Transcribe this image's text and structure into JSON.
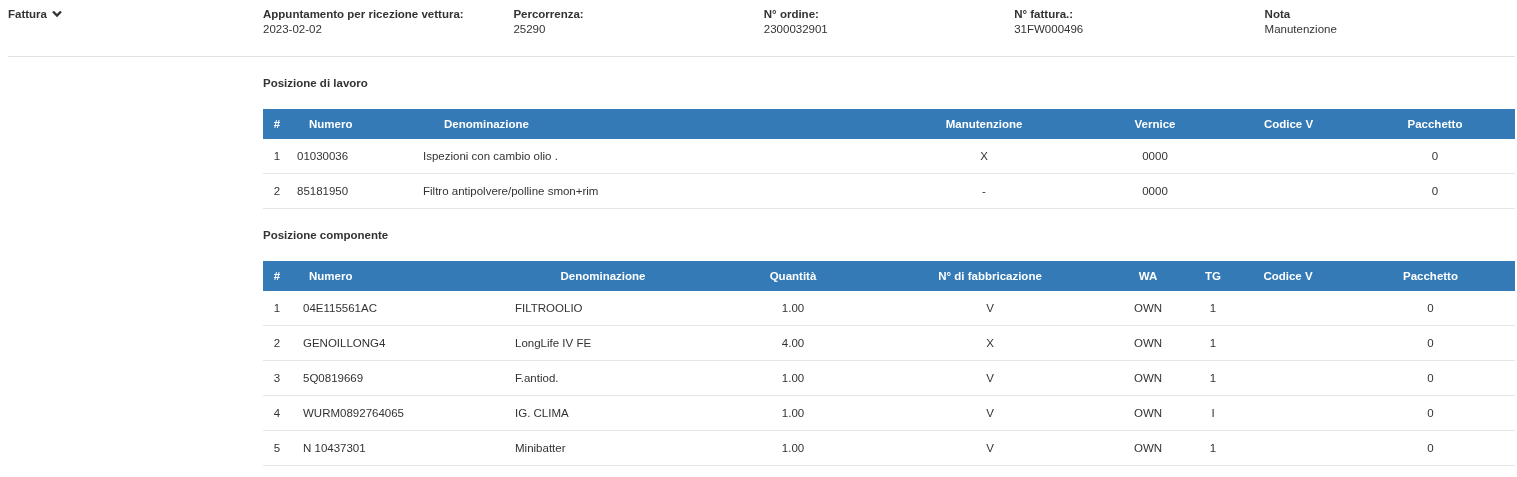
{
  "section": {
    "title": "Fattura",
    "expanded": true
  },
  "fields": [
    {
      "label": "Appuntamento per ricezione vettura:",
      "value": "2023-02-02"
    },
    {
      "label": "Percorrenza:",
      "value": "25290"
    },
    {
      "label": "N° ordine:",
      "value": "2300032901"
    },
    {
      "label": "N° fattura.:",
      "value": "31FW000496"
    },
    {
      "label": "Nota",
      "value": "Manutenzione"
    }
  ],
  "tables": [
    {
      "title": "Posizione di lavoro",
      "columns": [
        "#",
        "Numero",
        "Denominazione",
        "Manutenzione",
        "Vernice",
        "Codice V",
        "Pacchetto"
      ],
      "rows": [
        [
          "1",
          "01030036",
          "Ispezioni con cambio olio .",
          "X",
          "0000",
          "",
          "0"
        ],
        [
          "2",
          "85181950",
          "Filtro antipolvere/polline smon+rim",
          "-",
          "0000",
          "",
          "0"
        ]
      ]
    },
    {
      "title": "Posizione componente",
      "columns": [
        "#",
        "Numero",
        "Denominazione",
        "Quantità",
        "N° di fabbricazione",
        "WA",
        "TG",
        "Codice V",
        "Pacchetto"
      ],
      "rows": [
        [
          "1",
          "04E115561AC",
          "FILTROOLIO",
          "1.00",
          "V",
          "OWN",
          "1",
          "",
          "0"
        ],
        [
          "2",
          "GENOILLONG4",
          "LongLife IV FE",
          "4.00",
          "X",
          "OWN",
          "1",
          "",
          "0"
        ],
        [
          "3",
          "5Q0819669",
          "F.antiod.",
          "1.00",
          "V",
          "OWN",
          "1",
          "",
          "0"
        ],
        [
          "4",
          "WURM0892764065",
          "IG. CLIMA",
          "1.00",
          "V",
          "OWN",
          "I",
          "",
          "0"
        ],
        [
          "5",
          "N 10437301",
          "Minibatter",
          "1.00",
          "V",
          "OWN",
          "1",
          "",
          "0"
        ]
      ]
    }
  ]
}
